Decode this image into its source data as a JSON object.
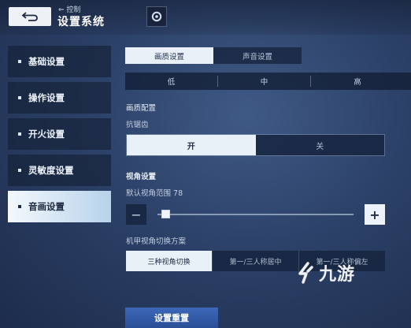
{
  "header": {
    "breadcrumb": "⇐ 控制",
    "title": "设置系统"
  },
  "sidebar": {
    "items": [
      {
        "label": "基础设置"
      },
      {
        "label": "操作设置"
      },
      {
        "label": "开火设置"
      },
      {
        "label": "灵敏度设置"
      },
      {
        "label": "音画设置"
      }
    ],
    "active_index": 4
  },
  "tabs": [
    {
      "label": "画质设置"
    },
    {
      "label": "声音设置"
    }
  ],
  "quality_levels": [
    "低",
    "中",
    "高"
  ],
  "picture_config": {
    "section_label": "画质配置",
    "antialias_label": "抗锯齿",
    "antialias_on": "开",
    "antialias_off": "关"
  },
  "view": {
    "section_label": "视角设置",
    "fov_label": "默认视角范围 78",
    "fov_fraction": 0.04,
    "minus": "−",
    "plus": "+"
  },
  "mech_view": {
    "label": "机甲视角切换方案",
    "options": [
      "三种视角切换",
      "第一/三人称居中",
      "第一/三人称偏左"
    ]
  },
  "reset_label": "设置重置",
  "watermark": "九游",
  "colors": {
    "accent_blue": "#3c67b8",
    "active_light": "#e8f0f8",
    "panel_dark": "#16243e"
  }
}
